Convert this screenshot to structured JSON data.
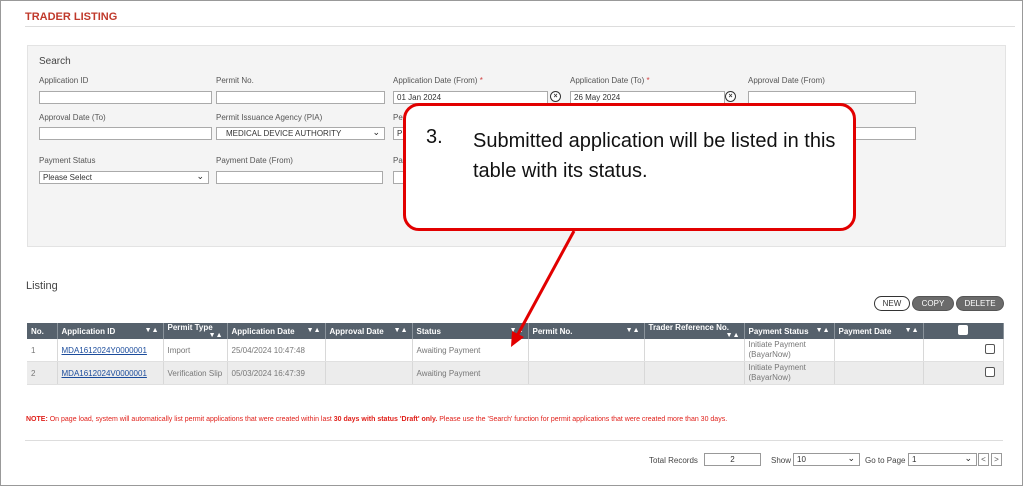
{
  "page_title": "TRADER LISTING",
  "search": {
    "heading": "Search",
    "application_id_label": "Application ID",
    "permit_no_label": "Permit No.",
    "app_date_from_label": "Application Date (From)",
    "app_date_to_label": "Application Date (To)",
    "approval_date_from_label": "Approval Date (From)",
    "approval_date_to_label": "Approval Date (To)",
    "pia_label": "Permit Issuance Agency (PIA)",
    "pia_value": "MEDICAL DEVICE AUTHORITY",
    "payment_status_label": "Payment Status",
    "payment_status_value": "Please Select",
    "payment_date_from_label": "Payment Date (From)",
    "app_date_from_value": "01 Jan 2024",
    "app_date_to_value": "26 May 2024",
    "required_mark": "*",
    "partial_label_a": "Pe",
    "partial_value_a": "P",
    "partial_label_b": "Pa"
  },
  "callout": {
    "number": "3.",
    "text": "Submitted application will be listed in this table with its status."
  },
  "listing": {
    "heading": "Listing",
    "new_label": "NEW",
    "copy_label": "COPY",
    "delete_label": "DELETE",
    "sort_glyph": "▼▲",
    "columns": [
      "No.",
      "Application ID",
      "Permit Type",
      "Application Date",
      "Approval Date",
      "Status",
      "Permit No.",
      "Trader Reference No.",
      "Payment Status",
      "Payment Date"
    ],
    "rows": [
      {
        "no": "1",
        "app_id": "MDA1612024Y0000001",
        "permit_type": "Import",
        "app_date": "25/04/2024 10:47:48",
        "approval_date": "",
        "status": "Awaiting Payment",
        "permit_no": "",
        "trader_ref": "",
        "payment_status": "Initiate Payment (BayarNow)",
        "payment_date": ""
      },
      {
        "no": "2",
        "app_id": "MDA1612024V0000001",
        "permit_type": "Verification Slip",
        "app_date": "05/03/2024 16:47:39",
        "approval_date": "",
        "status": "Awaiting Payment",
        "permit_no": "",
        "trader_ref": "",
        "payment_status": "Initiate Payment (BayarNow)",
        "payment_date": ""
      }
    ]
  },
  "note": {
    "prefix": "NOTE:",
    "text1": " On page load, system will automatically list permit applications that were created within last ",
    "bold": "30 days with status 'Draft' only.",
    "text2": " Please use the 'Search' function for permit applications that were created more than 30 days."
  },
  "pager": {
    "total_label": "Total Records",
    "total_value": "2",
    "show_label": "Show",
    "show_value": "10",
    "goto_label": "Go to Page",
    "goto_value": "1",
    "prev_glyph": "<",
    "next_glyph": ">"
  },
  "colors": {
    "title": "#c0392b",
    "callout_border": "#e20000",
    "table_header": "#56616c",
    "note": "#e0201a",
    "link": "#1b4c9c"
  }
}
